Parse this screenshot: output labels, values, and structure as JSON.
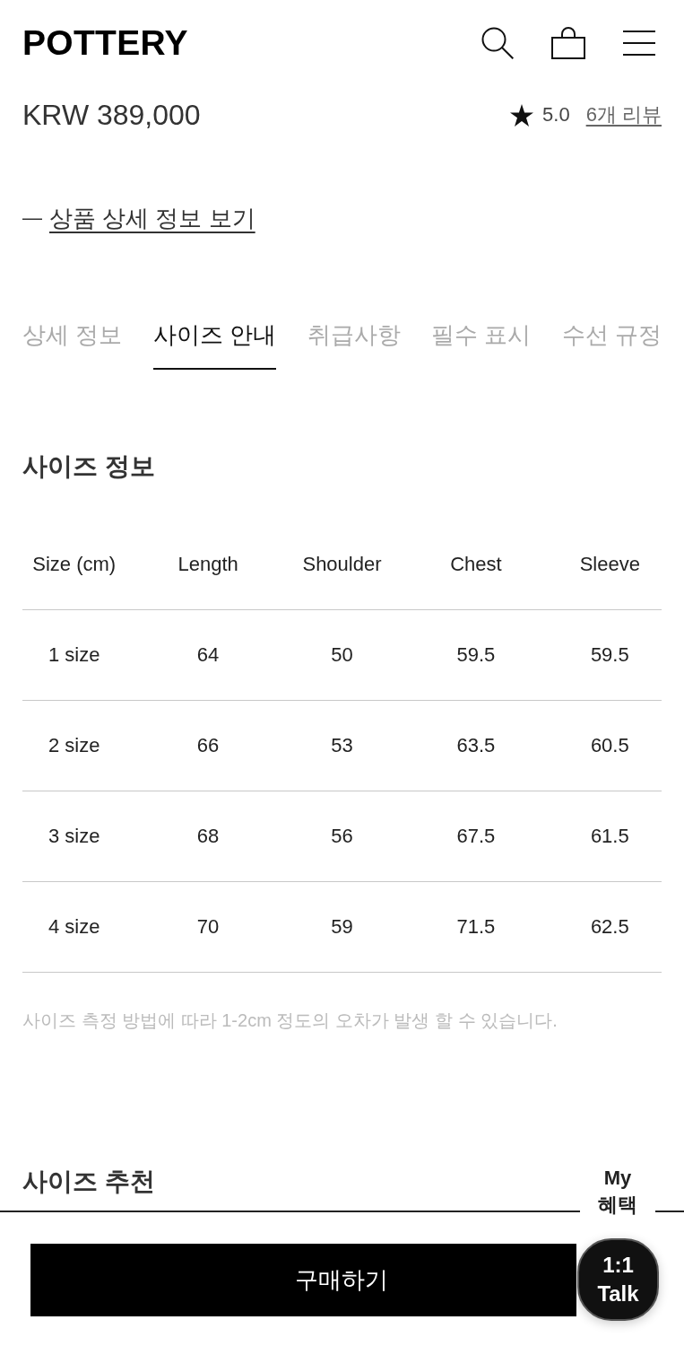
{
  "header": {
    "logo": "POTTERY"
  },
  "product": {
    "price": "KRW 389,000",
    "rating": {
      "score": "5.0",
      "reviews": "6개 리뷰"
    }
  },
  "detail_link": {
    "prefix": "—",
    "label": "상품 상세 정보 보기"
  },
  "tabs": [
    {
      "label": "상세 정보",
      "selected": false
    },
    {
      "label": "사이즈 안내",
      "selected": true
    },
    {
      "label": "취급사항",
      "selected": false
    },
    {
      "label": "필수 표시",
      "selected": false
    },
    {
      "label": "수선 규정",
      "selected": false
    }
  ],
  "size_info": {
    "title": "사이즈 정보",
    "table": {
      "columns": [
        "Size (cm)",
        "Length",
        "Shoulder",
        "Chest",
        "Sleeve"
      ],
      "rows": [
        [
          "1 size",
          "64",
          "50",
          "59.5",
          "59.5"
        ],
        [
          "2 size",
          "66",
          "53",
          "63.5",
          "60.5"
        ],
        [
          "3 size",
          "68",
          "56",
          "67.5",
          "61.5"
        ],
        [
          "4 size",
          "70",
          "59",
          "71.5",
          "62.5"
        ]
      ]
    },
    "note": "사이즈 측정 방법에 따라 1-2cm 정도의 오차가 발생 할 수 있습니다."
  },
  "size_recommend": {
    "title": "사이즈 추천"
  },
  "buy_button": {
    "label": "구매하기"
  },
  "floating": {
    "benefits": {
      "lines": [
        "My",
        "혜택"
      ]
    },
    "talk": {
      "lines": [
        "1:1",
        "Talk"
      ]
    }
  }
}
